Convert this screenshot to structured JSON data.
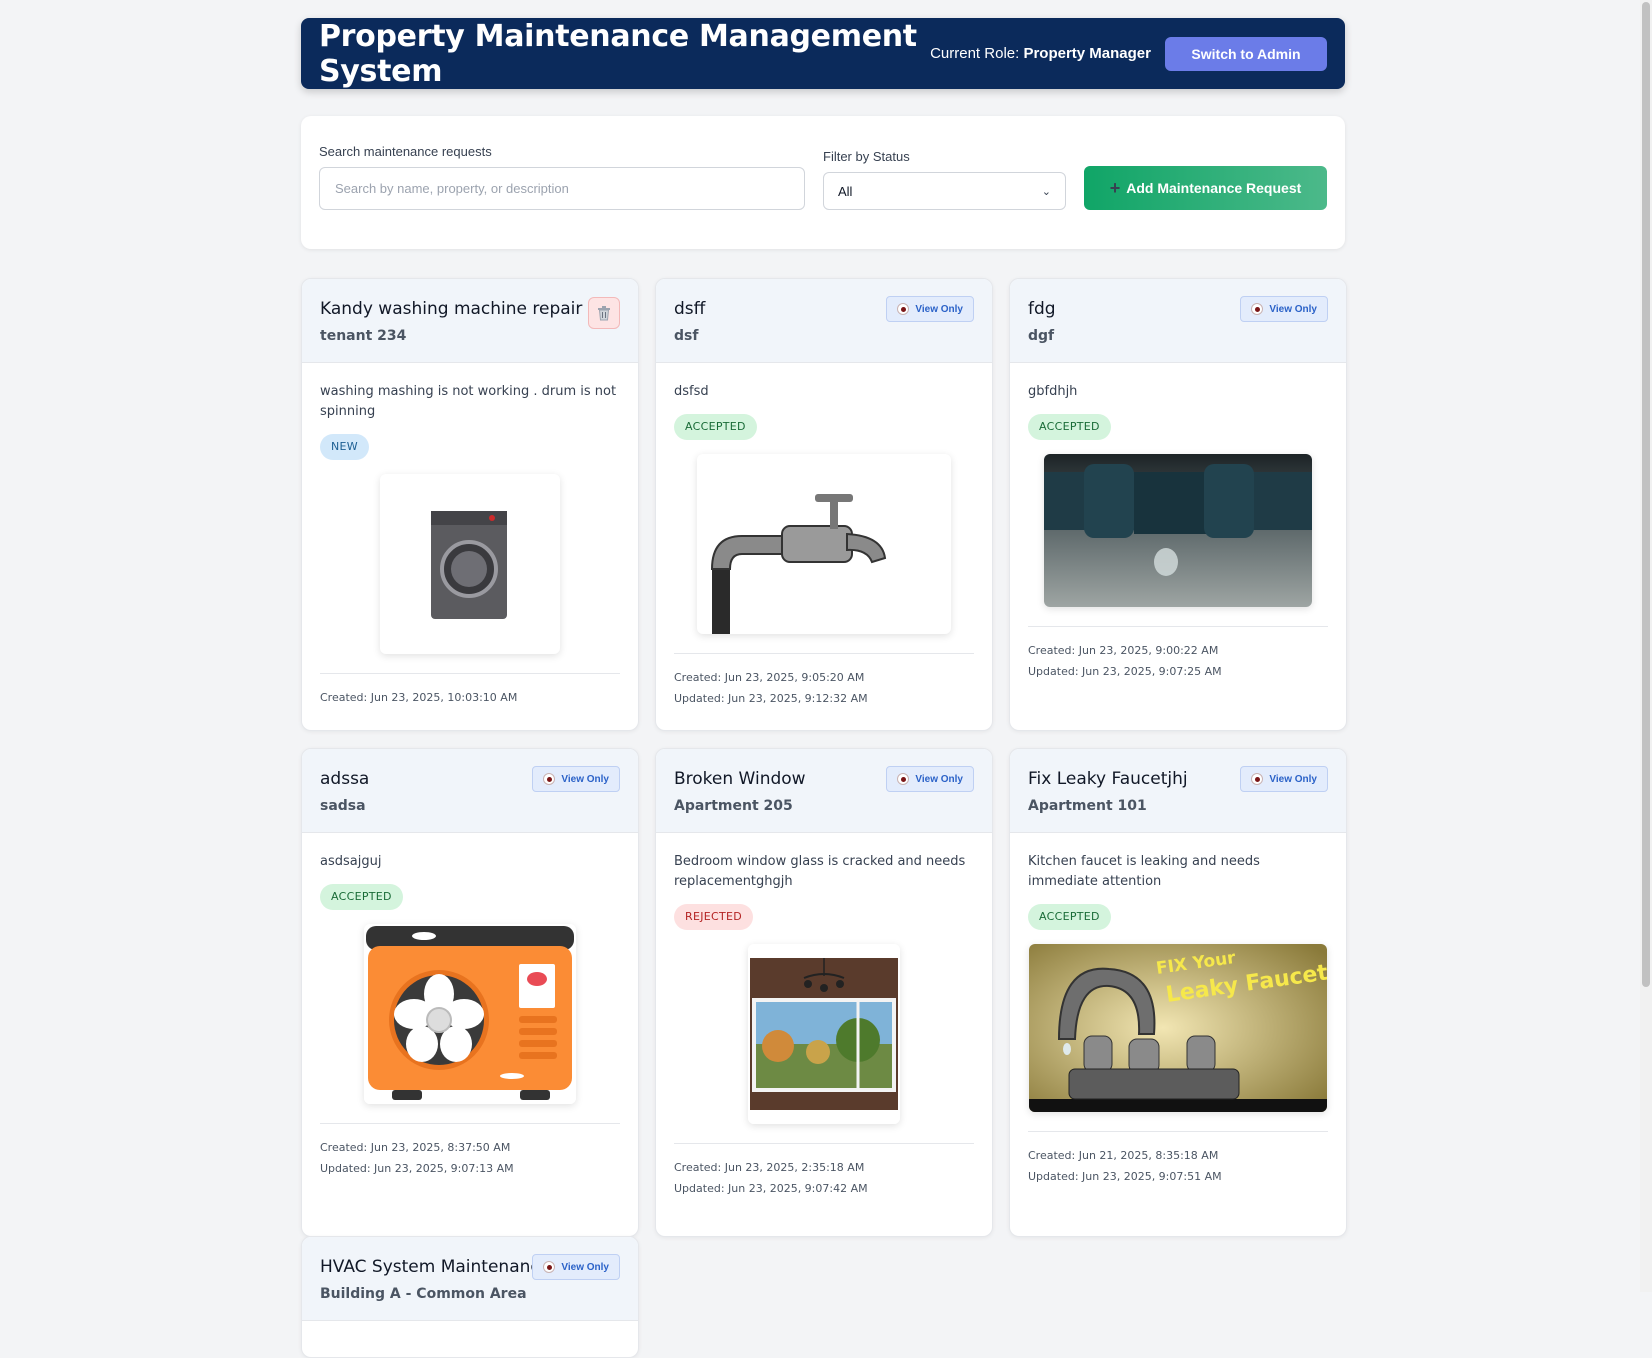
{
  "header": {
    "title": "Property Maintenance Management System",
    "role_prefix": "Current Role:",
    "role_value": "Property Manager",
    "switch_label": "Switch to Admin"
  },
  "controls": {
    "search_label": "Search maintenance requests",
    "search_placeholder": "Search by name, property, or description",
    "search_value": "",
    "filter_label": "Filter by Status",
    "filter_value": "All",
    "add_label": "Add Maintenance Request"
  },
  "view_only_label": "View Only",
  "cards": [
    {
      "title": "Kandy washing machine repair",
      "property": "tenant 234",
      "description": "washing mashing is not working . drum is not spinning",
      "status": "NEW",
      "created": "Created: Jun 23, 2025, 10:03:10 AM",
      "updated": ""
    },
    {
      "title": "dsff",
      "property": "dsf",
      "description": "dsfsd",
      "status": "ACCEPTED",
      "created": "Created: Jun 23, 2025, 9:05:20 AM",
      "updated": "Updated: Jun 23, 2025, 9:12:32 AM"
    },
    {
      "title": "fdg",
      "property": "dgf",
      "description": "gbfdhjh",
      "status": "ACCEPTED",
      "created": "Created: Jun 23, 2025, 9:00:22 AM",
      "updated": "Updated: Jun 23, 2025, 9:07:25 AM"
    },
    {
      "title": "adssa",
      "property": "sadsa",
      "description": "asdsajguj",
      "status": "ACCEPTED",
      "created": "Created: Jun 23, 2025, 8:37:50 AM",
      "updated": "Updated: Jun 23, 2025, 9:07:13 AM"
    },
    {
      "title": "Broken Window",
      "property": "Apartment 205",
      "description": "Bedroom window glass is cracked and needs replacementghgjh",
      "status": "REJECTED",
      "created": "Created: Jun 23, 2025, 2:35:18 AM",
      "updated": "Updated: Jun 23, 2025, 9:07:42 AM"
    },
    {
      "title": "Fix Leaky Faucetjhj",
      "property": "Apartment 101",
      "description": "Kitchen faucet is leaking and needs immediate attention",
      "status": "ACCEPTED",
      "created": "Created: Jun 21, 2025, 8:35:18 AM",
      "updated": "Updated: Jun 23, 2025, 9:07:51 AM",
      "image_caption_1": "FIX Your",
      "image_caption_2": "Leaky Faucet!"
    },
    {
      "title": "HVAC System Maintenance",
      "property": "Building A - Common Area"
    }
  ],
  "colors": {
    "header_bg": "#0b2a5b",
    "switch_btn": "#6b7ce8",
    "add_btn": "#10a567",
    "new_badge": "#d2e8fa",
    "accepted_badge": "#d4f4dd",
    "rejected_badge": "#fde0e0"
  }
}
